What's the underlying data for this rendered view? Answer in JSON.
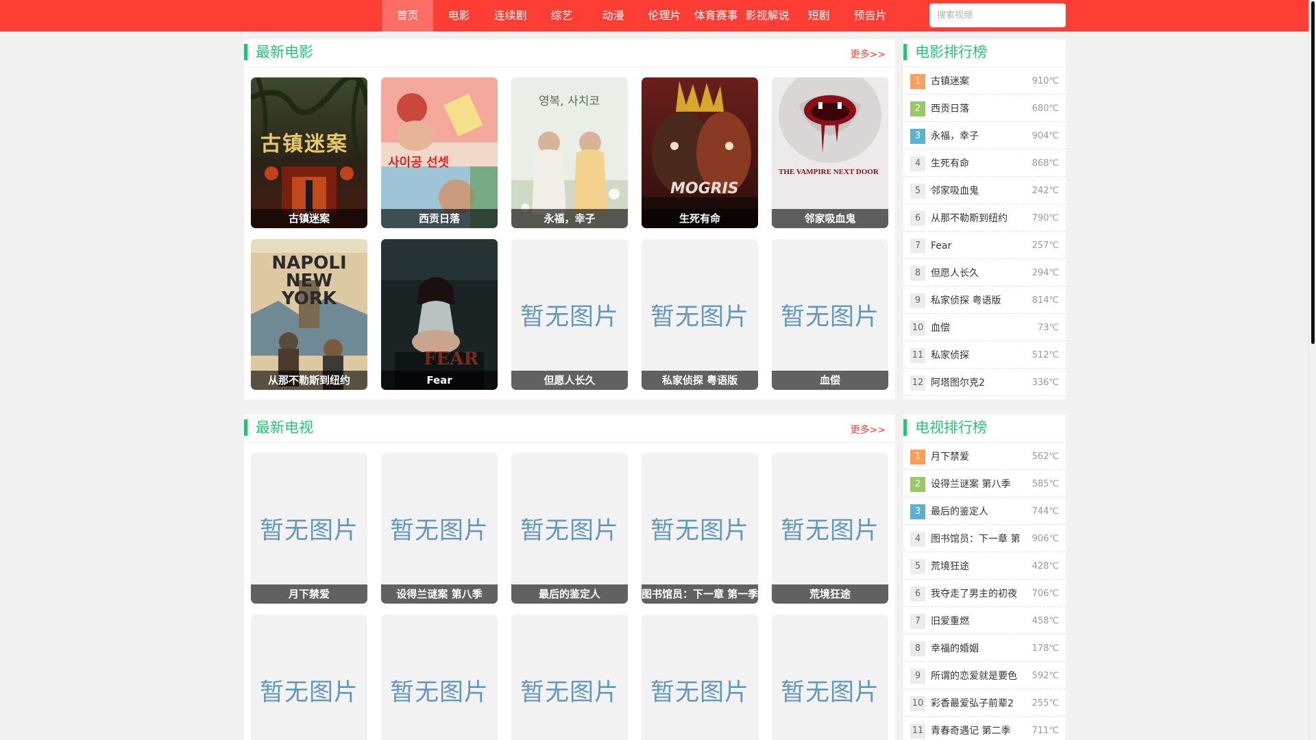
{
  "nav": {
    "items": [
      "首页",
      "电影",
      "连续剧",
      "综艺",
      "动漫",
      "伦理片",
      "体育赛事",
      "影视解说",
      "短剧",
      "预告片"
    ],
    "active_index": 0
  },
  "search": {
    "placeholder": "搜索视频"
  },
  "placeholder_text": "暂无图片",
  "movies": {
    "title": "最新电影",
    "more": "更多>>",
    "cards": [
      {
        "name": "古镇迷案",
        "has_image": true
      },
      {
        "name": "西贡日落",
        "has_image": true,
        "poster_text": "사이공 선셋"
      },
      {
        "name": "永福，幸子",
        "has_image": true,
        "poster_text": "영복, 사치코"
      },
      {
        "name": "生死有命",
        "has_image": true,
        "poster_text": "MOGRIS"
      },
      {
        "name": "邻家吸血鬼",
        "has_image": true,
        "poster_text": "THE VAMPIRE NEXT DOOR"
      },
      {
        "name": "从那不勒斯到纽约",
        "has_image": true,
        "poster_text": "NAPOLI NEW YORK"
      },
      {
        "name": "Fear",
        "has_image": true,
        "poster_text": "FEAR"
      },
      {
        "name": "但愿人长久",
        "has_image": false
      },
      {
        "name": "私家侦探 粤语版",
        "has_image": false
      },
      {
        "name": "血偿",
        "has_image": false
      }
    ]
  },
  "movie_rank": {
    "title": "电影排行榜",
    "items": [
      {
        "rank": "1",
        "name": "古镇迷案",
        "heat": "910℃"
      },
      {
        "rank": "2",
        "name": "西贡日落",
        "heat": "680℃"
      },
      {
        "rank": "3",
        "name": "永福，幸子",
        "heat": "904℃"
      },
      {
        "rank": "4",
        "name": "生死有命",
        "heat": "868℃"
      },
      {
        "rank": "5",
        "name": "邻家吸血鬼",
        "heat": "242℃"
      },
      {
        "rank": "6",
        "name": "从那不勒斯到纽约",
        "heat": "790℃"
      },
      {
        "rank": "7",
        "name": "Fear",
        "heat": "257℃"
      },
      {
        "rank": "8",
        "name": "但愿人长久",
        "heat": "294℃"
      },
      {
        "rank": "9",
        "name": "私家侦探 粤语版",
        "heat": "814℃"
      },
      {
        "rank": "10",
        "name": "血偿",
        "heat": "73℃"
      },
      {
        "rank": "11",
        "name": "私家侦探",
        "heat": "512℃"
      },
      {
        "rank": "12",
        "name": "阿塔图尔克2",
        "heat": "336℃"
      }
    ]
  },
  "tv": {
    "title": "最新电视",
    "more": "更多>>",
    "cards": [
      {
        "name": "月下禁爱",
        "has_image": false
      },
      {
        "name": "设得兰谜案 第八季",
        "has_image": false
      },
      {
        "name": "最后的鉴定人",
        "has_image": false
      },
      {
        "name": "图书馆员：下一章 第一季",
        "has_image": false
      },
      {
        "name": "荒境狂途",
        "has_image": false
      },
      {
        "name": "",
        "has_image": false
      },
      {
        "name": "",
        "has_image": false
      },
      {
        "name": "",
        "has_image": false
      },
      {
        "name": "",
        "has_image": false
      },
      {
        "name": "",
        "has_image": false
      }
    ]
  },
  "tv_rank": {
    "title": "电视排行榜",
    "items": [
      {
        "rank": "1",
        "name": "月下禁爱",
        "heat": "562℃"
      },
      {
        "rank": "2",
        "name": "设得兰谜案 第八季",
        "heat": "585℃"
      },
      {
        "rank": "3",
        "name": "最后的鉴定人",
        "heat": "744℃"
      },
      {
        "rank": "4",
        "name": "图书馆员：下一章 第",
        "heat": "906℃"
      },
      {
        "rank": "5",
        "name": "荒境狂途",
        "heat": "428℃"
      },
      {
        "rank": "6",
        "name": "我夺走了男主的初夜",
        "heat": "706℃"
      },
      {
        "rank": "7",
        "name": "旧爱重燃",
        "heat": "458℃"
      },
      {
        "rank": "8",
        "name": "幸福的婚姻",
        "heat": "178℃"
      },
      {
        "rank": "9",
        "name": "所谓的恋爱就是要色",
        "heat": "592℃"
      },
      {
        "rank": "10",
        "name": "彩香最爱弘子前辈2",
        "heat": "255℃"
      },
      {
        "rank": "11",
        "name": "青春奇遇记 第二季",
        "heat": "711℃"
      }
    ]
  },
  "colors": {
    "brand": "#fe3d34",
    "accent": "#2bc07a",
    "placeholder": "#6498ba"
  }
}
